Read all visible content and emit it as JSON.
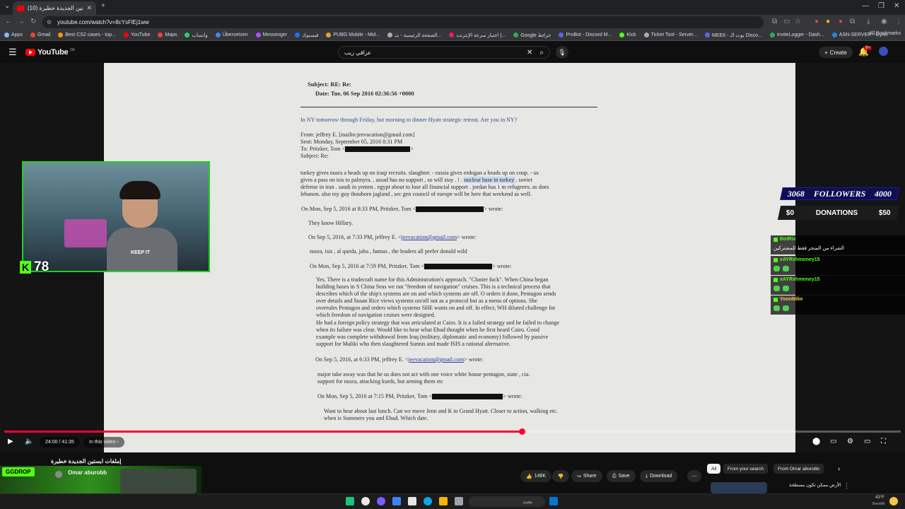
{
  "browser": {
    "tab_title": "(10) ملفات ابستين الجديدة خطيرة",
    "url": "youtube.com/watch?v=8cYsFlEj1ww",
    "bookmarks": [
      "Apps",
      "Gmail",
      "Best CS2 cases - top...",
      "YouTube",
      "Maps",
      "واتساب",
      "Übersetzen",
      "Messenger",
      "فيسبوك",
      "PUBG Mobile - Mid...",
      "الصفحة الرئيسية - بنـ...",
      "اختبار سرعة الإنترنت |...",
      "Google خرائط",
      "ProBot - Discord M...",
      "Kick",
      "Ticket Tool - Server...",
      "MEE6 - بوت الـ Disco...",
      "InviteLogger - Dash...",
      "ASN-SERVER - Oyno"
    ],
    "all_bookmarks": "All Bookmarks"
  },
  "youtube": {
    "logo": "YouTube",
    "region": "DE",
    "search_query": "عراقي ريب",
    "create_label": "Create",
    "notif_badge": "9+"
  },
  "email": {
    "subject": "Subject: RE: Re:",
    "date": "Date: Tue, 06 Sep 2016 02:36:56 +0000",
    "intro": "In NY tomorrow through Friday, but morning to dinner Hyatt strategic retreat.  Are you in NY?",
    "from": "From: jeffrey E. [mailto:jeevacation@gmail.com]",
    "sent": "Sent: Monday, September 05, 2016 8:31 PM",
    "to": "To: Pritzker, Tom <",
    "subj2": "Subject: Re:",
    "p1a": "turkey gives nusra a heads up on iraqi recruits.    slaughter.  -  russia gives erdogan a heads up on coup.  -  us",
    "p1b_pre": "gives a pass on isis to palmyra.  .   assad has no support , so will stay . !  .   ",
    "p1b_hl": "nuclear base in turkey ",
    "p1b_post": " .   soviet",
    "p1c": "defense in iran  .  saudi in yemen  .  egypt  about to lose all financial support  .  jordan has 1 m refugeees.  as does",
    "p1d": "lebanon.    also  my guy thouborn jagland  ,  sec gen council of europe will be here that weekend as well.",
    "w1": "On Mon, Sep 5, 2016 at 8:33 PM, Pritzker, Tom <",
    "w1end": "> wrote:",
    "they_know": "They know Hillary.",
    "w2pre": "On Sep 5, 2016, at 7:33 PM, jeffrey E. <",
    "w2link": "jeevacation@gmail.com",
    "w2end": "> wrote:",
    "line_nusra": "nusra, isis , al queda, jaba , hamas ,  the leaders all prefer donald  wild",
    "w3": "On Mon, Sep 5, 2016 at 7:59 PM, Pritzker, Tom <",
    "w3end": "> wrote:",
    "para": [
      "Yes.  There is a tradecraft name for this Administration's approach.  \"Cluster fuck\".  When China began",
      "building bases in S China Seas we ran \"freedom of navigation\" cruises.  This is a technical process that",
      "describes which of the ship's systems are on and which systems are off.  O orders it done, Pentagon sends",
      "over details and Susan Rice views systems on/off not as a protocol but as a menu of options.  She",
      "overrules Pentagon and orders which systems SHE wants on and off.  In effect, WH diluted challenge for",
      "which freedom of navigation cruises were designed.",
      "He had a foreign policy strategy that was articulated at Cairo.  It is a failed strategy and he failed to change",
      "when its failure was clear.   Would like to hear what Ehud thought when he first heard Cairo.  Good",
      "example was complete withdrawal from Iraq (military, diplomatic and economy) followed by passive",
      "support for Maliki who then slaughtered Sunnis and made ISIS a rational alternative."
    ],
    "w4pre": "On Sep 5, 2016, at 6:33 PM, jeffrey E. <",
    "w4link": "jeevacation@gmail.com",
    "w4end": "> wrote:",
    "major1": "major take away was  that he us does not act with one voice     white house pentagon,  state , cia.",
    "major2": "support for nusra, attacking kurds, but arming them  etc",
    "w5": "On Mon, Sep 5, 2016 at 7:15 PM, Pritzker, Tom <",
    "w5end": "> wrote:",
    "want1": "Want to hear about last lunch.  Can we move Jenn and K to Grand Hyatt.  Closer to action, walking etc.",
    "want2": "when is Summers you and Ehud.  Which date."
  },
  "stream": {
    "kick_viewers": "78",
    "shirt_text": "KEEP IT",
    "followers_current": "3068",
    "followers_label": "FOLLOWERS",
    "followers_goal": "4000",
    "donations_current": "$0",
    "donations_label": "DONATIONS",
    "donations_goal": "$50",
    "chat": [
      {
        "name": "BotRix",
        "msg": "الشراء من المتجر فقط للمشتركين",
        "color": "#53fc18"
      },
      {
        "name": "xAYRxhmoney15",
        "msg": "",
        "color": "#53fc18"
      },
      {
        "name": "xAYRxhmoney15",
        "msg": "",
        "color": "#53fc18"
      },
      {
        "name": "YoonMike",
        "msg": "",
        "color": "#f4c542"
      }
    ]
  },
  "player": {
    "time": "24:00 / 41:35",
    "chapter": "In this video",
    "progress": 0.577
  },
  "below": {
    "title": "إملفات ابستين الجديدة خطيرة",
    "channel": "Omar aburobb",
    "ad_brand": "GGDROP",
    "likes": "146K",
    "share": "Share",
    "save": "Save",
    "download": "Download",
    "chips": [
      "All",
      "From your search",
      "From Omar aburobb"
    ],
    "rec_title": "الأرض ممكن تكون مسطحة"
  },
  "taskbar": {
    "search": "بحث",
    "weather": "43°F",
    "weather_sub": "Bewölkt"
  }
}
